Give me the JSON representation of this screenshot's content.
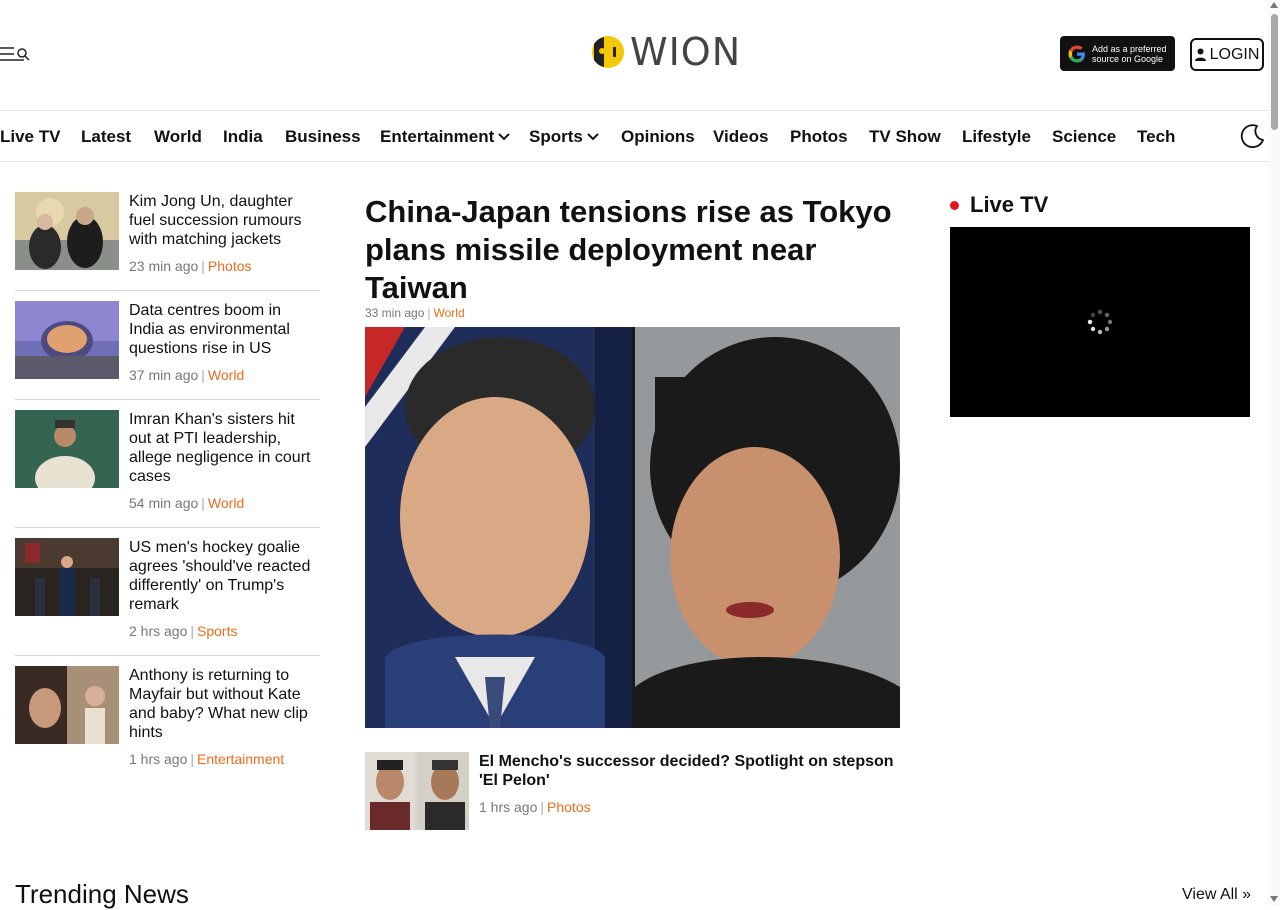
{
  "header": {
    "logo_text": "WION",
    "google_badge_line1": "Add as a preferred",
    "google_badge_line2": "source on Google",
    "login_label": "LOGIN"
  },
  "nav": {
    "items": [
      {
        "label": "Live TV"
      },
      {
        "label": "Latest"
      },
      {
        "label": "World"
      },
      {
        "label": "India"
      },
      {
        "label": "Business"
      },
      {
        "label": "Entertainment",
        "dropdown": true
      },
      {
        "label": "Sports",
        "dropdown": true
      },
      {
        "label": "Opinions"
      },
      {
        "label": "Videos"
      },
      {
        "label": "Photos"
      },
      {
        "label": "TV Show"
      },
      {
        "label": "Lifestyle"
      },
      {
        "label": "Science"
      },
      {
        "label": "Tech"
      }
    ]
  },
  "left_stories": [
    {
      "title": "Kim Jong Un, daughter fuel succession rumours with matching jackets",
      "time": "23 min ago",
      "category": "Photos"
    },
    {
      "title": "Data centres boom in India as environmental questions rise in US",
      "time": "37 min ago",
      "category": "World"
    },
    {
      "title": "Imran Khan's sisters hit out at PTI leadership, allege negligence in court cases",
      "time": "54 min ago",
      "category": "World"
    },
    {
      "title": "US men's hockey goalie agrees 'should've reacted differently' on Trump's remark",
      "time": "2 hrs ago",
      "category": "Sports"
    },
    {
      "title": "Anthony is returning to Mayfair but without Kate and baby? What new clip hints",
      "time": "1 hrs ago",
      "category": "Entertainment"
    }
  ],
  "main_story": {
    "title": "China-Japan tensions rise as Tokyo plans missile deployment near Taiwan",
    "time": "33 min ago",
    "category": "World"
  },
  "sub_story": {
    "title": "El Mencho's successor decided? Spotlight on stepson 'El Pelon'",
    "time": "1 hrs ago",
    "category": "Photos"
  },
  "live_tv": {
    "title": "Live TV"
  },
  "trending": {
    "title": "Trending News",
    "view_all": "View All »"
  },
  "colors": {
    "accent": "#ef6c1a",
    "live_dot": "#e4131b",
    "logo_yellow": "#f5c800"
  },
  "icons": [
    "menu-icon",
    "search-icon",
    "google-g-icon",
    "user-icon",
    "chevron-down-icon",
    "moon-icon",
    "loading-spinner-icon"
  ]
}
